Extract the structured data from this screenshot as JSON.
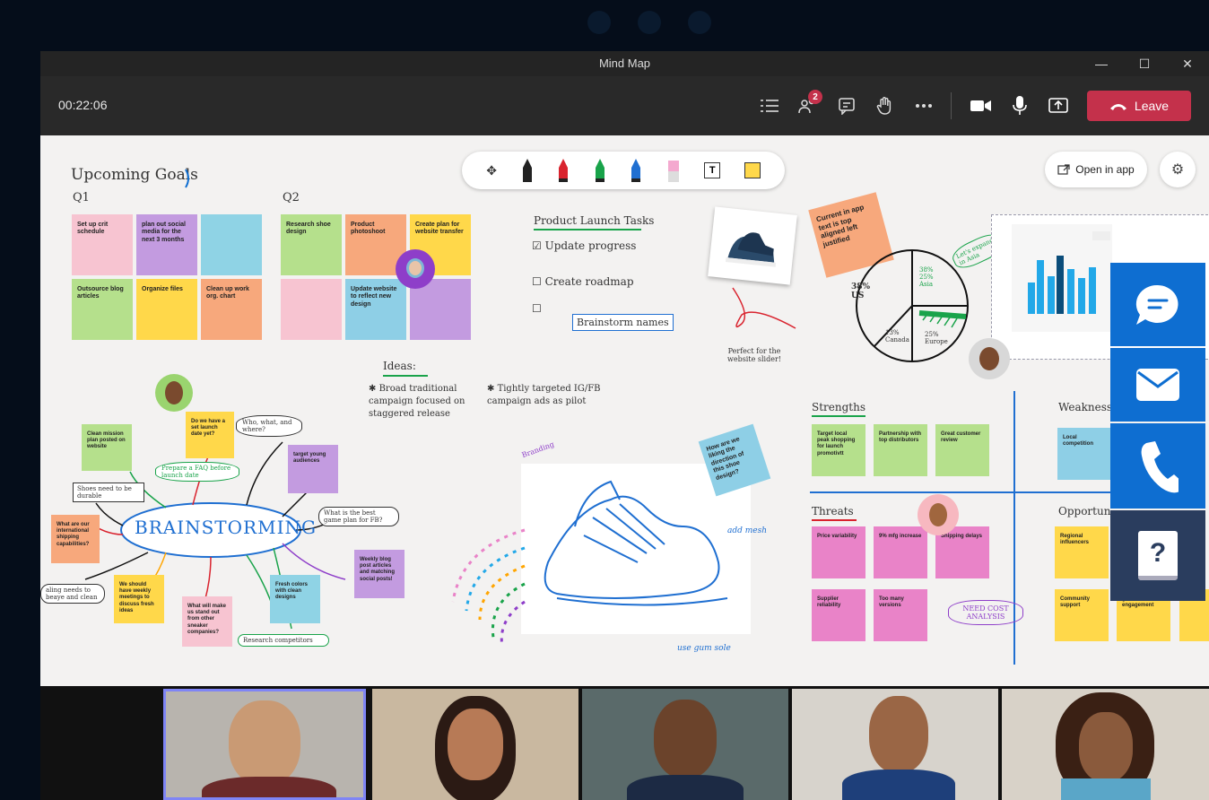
{
  "window": {
    "title": "Mind Map",
    "controls": [
      "—",
      "☐",
      "✕"
    ]
  },
  "toolbar": {
    "timer": "00:22:06",
    "participants_badge": "2",
    "leave_label": "Leave"
  },
  "board": {
    "goals_title": "Upcoming Goals",
    "q1": "Q1",
    "q2": "Q2",
    "q1_notes": [
      "Set up crit schedule",
      "plan out social media for the next 3 months",
      "",
      "Outsource blog articles",
      "Organize files",
      "Clean up work org. chart"
    ],
    "q2_notes": [
      "Research shoe design",
      "Product photoshoot",
      "Create plan for website transfer",
      "",
      "Update website to reflect new design",
      ""
    ],
    "tasks_title": "Product Launch Tasks",
    "tasks": [
      "Update progress",
      "Create roadmap",
      ""
    ],
    "brainstorm_box": "Brainstorm names",
    "ideas_title": "Ideas:",
    "idea1": "Broad traditional campaign focused on staggered release",
    "idea2": "Tightly targeted IG/FB campaign ads as pilot",
    "sticky_app": "Current in app text is top aligned left justified",
    "slider_note": "Perfect for the website slider!",
    "pie_labels": {
      "us": "38% US",
      "asia": "38% 25% Asia",
      "canada": "13% Canada",
      "europe": "25% Europe",
      "expand": "Let's expand in Asia"
    },
    "brainstorming": "BRAINSTORMING",
    "mind_notes": [
      "Clean mission plan posted on website",
      "Do we have a set launch date yet?",
      "target young audiences",
      "What are our international shipping capabilities?",
      "Weekly blog post articles and matching social posts!",
      "We should have weekly meetings to discuss fresh ideas",
      "What will make us stand out from other sneaker companies?",
      "Fresh colors with clean designs"
    ],
    "mind_bubbles": [
      "Who, what, and where?",
      "Prepare a FAQ before launch date",
      "Shoes need to be durable",
      "What is the best game plan for FB?",
      "aling needs to beaye and clean",
      "Research competitors"
    ],
    "sketch_notes": {
      "branding": "Branding",
      "how_note": "How are we liking the direction of this shoe design?",
      "mesh": "add mesh",
      "gum": "use gum sole"
    },
    "strengths": "Strengths",
    "strength_notes": [
      "Target local peak shopping for launch promotivtt",
      "Partnership with top distributors",
      "Great customer review"
    ],
    "weakness": "Weakness",
    "weakness_notes": [
      "Local competition"
    ],
    "threats": "Threats",
    "threat_notes": [
      "Price variability",
      "9% mfg increase",
      "Shipping delays",
      "Supplier reliability",
      "Too many versions"
    ],
    "need_cost": "NEED COST ANALYSIS",
    "opportunities": "Opportun",
    "opp_notes": [
      "Regional influencers",
      "",
      "Community support",
      "government engagement"
    ],
    "open_in_app": "Open in app"
  },
  "sidebar": {
    "icons": [
      "chat-icon",
      "mail-icon",
      "phone-icon",
      "help-icon"
    ],
    "help_glyph": "?"
  },
  "colors": {
    "accent": "#0e6ed1",
    "leave": "#c4314b",
    "board": "#f3f2f1"
  }
}
